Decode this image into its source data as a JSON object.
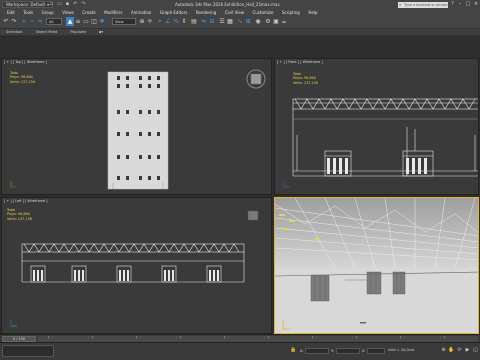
{
  "titlebar": {
    "workspace": "Workspace: Default",
    "app_title": "Autodesk 3ds Max 2016    Exhibition_Hall_25max.max",
    "search_placeholder": "Type a keyword or phrase"
  },
  "menu": [
    "Edit",
    "Tools",
    "Group",
    "Views",
    "Create",
    "Modifiers",
    "Animation",
    "Graph Editors",
    "Rendering",
    "Civil View",
    "Customize",
    "Scripting",
    "Help"
  ],
  "toolbar": {
    "selection_filter": "All",
    "reference_coord": "View"
  },
  "ribbon": [
    "Selection",
    "Object Paint",
    "Populate"
  ],
  "viewports": {
    "top": {
      "label": "[ + ] [ Top ] [ Wireframe ]",
      "stats_title": "Total",
      "polys_label": "Polys:",
      "polys_value": "96,864",
      "verts_label": "Verts:",
      "verts_value": "137,156"
    },
    "front": {
      "label": "[ + ] [ Front ] [ Wireframe ]",
      "stats_title": "Total",
      "polys_label": "Polys:",
      "polys_value": "96,864",
      "verts_label": "Verts:",
      "verts_value": "137,156"
    },
    "left": {
      "label": "[ + ] [ Left ] [ Wireframe ]",
      "stats_title": "Total",
      "polys_label": "Polys:",
      "polys_value": "96,864",
      "verts_label": "Verts:",
      "verts_value": "137,156"
    },
    "perspective": {
      "label": "[ + ] [ Perspective ] [ Realistic ]"
    }
  },
  "timeline": {
    "frame": "0 / 100"
  },
  "status": {
    "x_label": "X:",
    "y_label": "Y:",
    "z_label": "Z:",
    "grid": "Grid = 10,0cm"
  },
  "colors": {
    "accent": "#3d9be9",
    "active_border": "#e2b62a",
    "stats_text": "#e6d24a",
    "viewport_bg": "#3a3a3a"
  }
}
